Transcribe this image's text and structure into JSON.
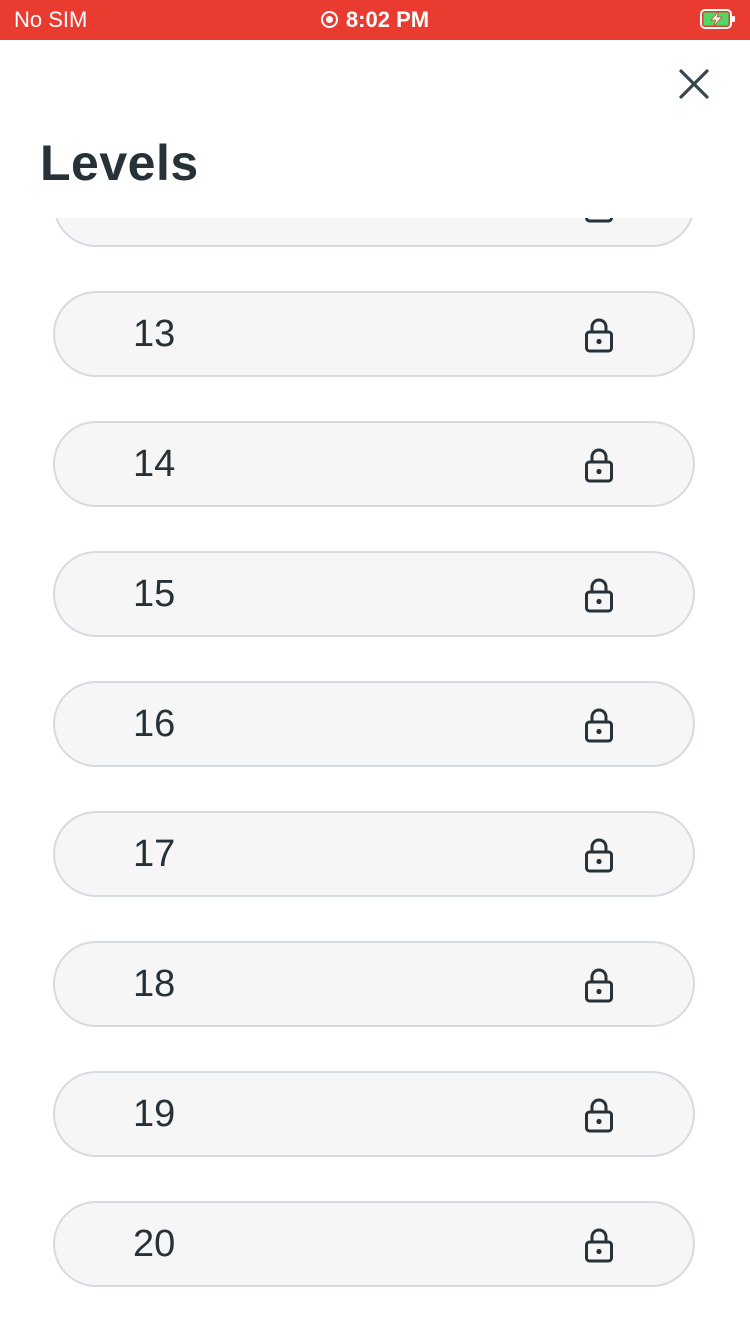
{
  "status_bar": {
    "carrier": "No SIM",
    "time": "8:02 PM",
    "background_color": "#ea3b30",
    "battery_color": "#4cd964"
  },
  "header": {
    "title": "Levels",
    "close_icon": "close-icon"
  },
  "levels": [
    {
      "number": "",
      "state": "locked",
      "icon": "lock-icon"
    },
    {
      "number": "13",
      "state": "locked",
      "icon": "lock-icon"
    },
    {
      "number": "14",
      "state": "locked",
      "icon": "lock-icon"
    },
    {
      "number": "15",
      "state": "locked",
      "icon": "lock-icon"
    },
    {
      "number": "16",
      "state": "locked",
      "icon": "lock-icon"
    },
    {
      "number": "17",
      "state": "locked",
      "icon": "lock-icon"
    },
    {
      "number": "18",
      "state": "locked",
      "icon": "lock-icon"
    },
    {
      "number": "19",
      "state": "locked",
      "icon": "lock-icon"
    },
    {
      "number": "20",
      "state": "locked",
      "icon": "lock-icon"
    }
  ]
}
